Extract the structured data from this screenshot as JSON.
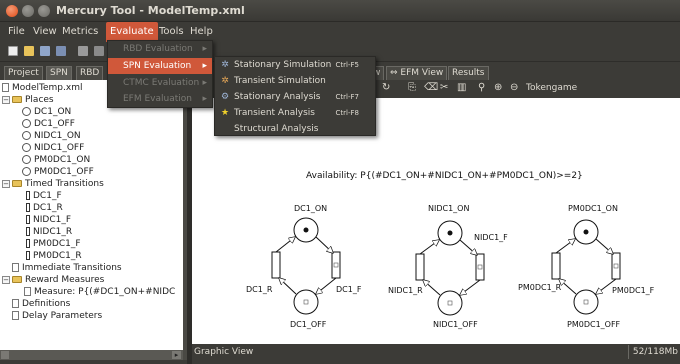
{
  "window": {
    "title": "Mercury Tool - ModelTemp.xml"
  },
  "menubar": [
    "File",
    "View",
    "Metrics",
    "Evaluate",
    "Tools",
    "Help"
  ],
  "evaluate_menu": {
    "items": [
      {
        "label": "RBD Evaluation",
        "enabled": false
      },
      {
        "label": "SPN Evaluation",
        "enabled": true,
        "highlighted": true
      },
      {
        "label": "CTMC Evaluation",
        "enabled": false
      },
      {
        "label": "EFM Evaluation",
        "enabled": false
      }
    ]
  },
  "spn_submenu": {
    "items": [
      {
        "label": "Stationary Simulation",
        "shortcut": "Ctrl-F5",
        "icon": "gear-icon"
      },
      {
        "label": "Transient Simulation",
        "shortcut": "",
        "icon": "gear-icon"
      },
      {
        "label": "Stationary Analysis",
        "shortcut": "Ctrl-F7",
        "icon": "gears-icon"
      },
      {
        "label": "Transient Analysis",
        "shortcut": "Ctrl-F8",
        "icon": "star-icon"
      },
      {
        "label": "Structural Analysis",
        "shortcut": "",
        "icon": ""
      }
    ]
  },
  "left_tabs": [
    "Project",
    "SPN",
    "RBD"
  ],
  "tree": {
    "root": "ModelTemp.xml",
    "places_label": "Places",
    "places": [
      "DC1_ON",
      "DC1_OFF",
      "NIDC1_ON",
      "NIDC1_OFF",
      "PM0DC1_ON",
      "PM0DC1_OFF"
    ],
    "timed_label": "Timed Transitions",
    "timed": [
      "DC1_F",
      "DC1_R",
      "NIDC1_F",
      "NIDC1_R",
      "PM0DC1_F",
      "PM0DC1_R"
    ],
    "immediate_label": "Immediate Transitions",
    "reward_label": "Reward Measures",
    "measure": "Measure: P{(#DC1_ON+#NIDC",
    "definitions_label": "Definitions",
    "delay_label": "Delay Parameters"
  },
  "right_tabs": [
    "w",
    "EFM View",
    "Results"
  ],
  "right_toolbar": {
    "tokengame_label": "Tokengame"
  },
  "canvas": {
    "formula": "Availability: P{(#DC1_ON+#NIDC1_ON+#PM0DC1_ON)>=2}",
    "nets": [
      {
        "on": "DC1_ON",
        "off": "DC1_OFF",
        "fail": "DC1_F",
        "repair": "DC1_R"
      },
      {
        "on": "NIDC1_ON",
        "off": "NIDC1_OFF",
        "fail": "NIDC1_F",
        "repair": "NIDC1_R"
      },
      {
        "on": "PM0DC1_ON",
        "off": "PM0DC1_OFF",
        "fail": "PM0DC1_F",
        "repair": "PM0DC1_R"
      }
    ]
  },
  "status": {
    "left": "Graphic View",
    "right": "52/118Mb"
  }
}
